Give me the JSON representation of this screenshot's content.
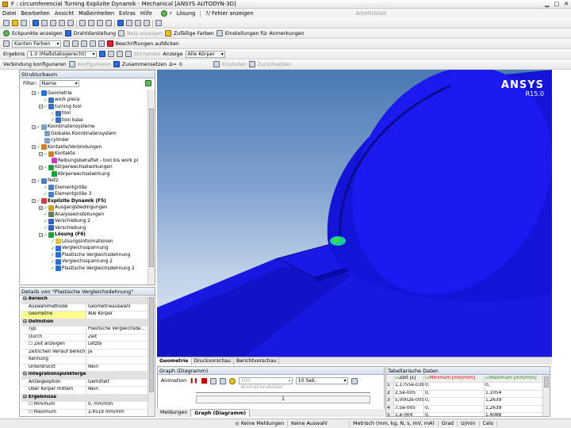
{
  "title": "F : circumferencial Turning Explizite Dynamik - Mechanical [ANSYS AUTODYN-3D]",
  "menu": [
    "Datei",
    "Bearbeiten",
    "Ansicht",
    "Maßeinheiten",
    "Extras",
    "Hilfe"
  ],
  "toolbar1": {
    "solve": "Lösung",
    "errors": "?/ Fehler anzeigen",
    "worksheet": "Arbeitsblatt"
  },
  "toolbar2": {
    "vertices": "Eckpunkte anzeigen",
    "wireframe": "Drahtdarstellung",
    "mesh": "Netz anzeigen",
    "random_colors": "Zufällige Farben",
    "annotation_settings": "Einstellungen für Anmerkungen"
  },
  "toolbar3": {
    "edges": "Kanten Farben",
    "labels": "Beschriftungen aufdicken"
  },
  "toolbar4": {
    "result_label": "Ergebnis",
    "scale": "1.0 (Maßstabsgerecht)",
    "probe": "Stichprobe",
    "show_label": "Anzeige",
    "all_bodies": "Alle Körper"
  },
  "toolbar5": {
    "connection": "Verbindung konfigurieren",
    "configure": "Konfigurieren",
    "merge": "Zusammensetzen",
    "delta": "Δ=",
    "delta_val": "0",
    "set": "Einstellen",
    "reset": "Zurücksetzen"
  },
  "tree_panel": {
    "title": "Strukturbaum",
    "filter_label": "Filter:",
    "filter_value": "Name",
    "items": [
      {
        "label": "Geometrie",
        "depth": 2,
        "color": "#2a6ed8",
        "exp": "−",
        "chk": true
      },
      {
        "label": "work piece",
        "depth": 3,
        "color": "#3a6fc0",
        "exp": "",
        "chk": true
      },
      {
        "label": "turning tool",
        "depth": 3,
        "color": "#3a6fc0",
        "exp": "−",
        "chk": true
      },
      {
        "label": "tool",
        "depth": 4,
        "color": "#3a6fc0",
        "exp": "",
        "chk": true
      },
      {
        "label": "tool base",
        "depth": 4,
        "color": "#3a6fc0",
        "exp": "",
        "chk": true
      },
      {
        "label": "Koordinatensysteme",
        "depth": 2,
        "color": "#7fa0c0",
        "exp": "−",
        "chk": true
      },
      {
        "label": "Globales Koordinatensystem",
        "depth": 3,
        "color": "#7fa0c0",
        "exp": "",
        "chk": false
      },
      {
        "label": "cylinder",
        "depth": 3,
        "color": "#7fa0c0",
        "exp": "",
        "chk": false
      },
      {
        "label": "Kontakte/Verbindungen",
        "depth": 2,
        "color": "#d08020",
        "exp": "−",
        "chk": true
      },
      {
        "label": "Kontakte",
        "depth": 3,
        "color": "#d08020",
        "exp": "−",
        "chk": true
      },
      {
        "label": "Reibungsbehaftet - tool bis work pi",
        "depth": 4,
        "color": "#c040c0",
        "exp": "",
        "chk": false
      },
      {
        "label": "Körperwechselwirkungen",
        "depth": 3,
        "color": "#20a040",
        "exp": "−",
        "chk": true
      },
      {
        "label": "Körperwechselwirkung",
        "depth": 4,
        "color": "#20a040",
        "exp": "",
        "chk": false
      },
      {
        "label": "Netz",
        "depth": 2,
        "color": "#4a80c0",
        "exp": "−",
        "chk": true
      },
      {
        "label": "Elementgröße",
        "depth": 3,
        "color": "#4a80c0",
        "exp": "",
        "chk": true
      },
      {
        "label": "Elementgröße 3",
        "depth": 3,
        "color": "#4a80c0",
        "exp": "",
        "chk": true
      },
      {
        "label": "Explizite Dynamik (F5)",
        "depth": 2,
        "color": "#d04040",
        "exp": "−",
        "chk": true,
        "bold": true
      },
      {
        "label": "Ausgangsbedingungen",
        "depth": 3,
        "color": "#d0a020",
        "exp": "+",
        "chk": true
      },
      {
        "label": "Analyseeinstellungen",
        "depth": 3,
        "color": "#608060",
        "exp": "",
        "chk": true
      },
      {
        "label": "Verschiebung 2",
        "depth": 3,
        "color": "#3060c0",
        "exp": "",
        "chk": true
      },
      {
        "label": "Verschiebung",
        "depth": 3,
        "color": "#3060c0",
        "exp": "",
        "chk": true
      },
      {
        "label": "Lösung (F6)",
        "depth": 3,
        "color": "#20a040",
        "exp": "−",
        "chk": true,
        "bold": true
      },
      {
        "label": "Lösungsinformationen",
        "depth": 4,
        "color": "#e0c040",
        "exp": "",
        "chk": true
      },
      {
        "label": "Vergleichsspannung",
        "depth": 4,
        "color": "#2a6ed8",
        "exp": "",
        "chk": true
      },
      {
        "label": "Plastische Vergleichsdehnung",
        "depth": 4,
        "color": "#2a6ed8",
        "exp": "",
        "chk": true
      },
      {
        "label": "Vergleichsspannung 2",
        "depth": 4,
        "color": "#2a6ed8",
        "exp": "",
        "chk": true
      },
      {
        "label": "Plastische Vergleichsdehnung 2",
        "depth": 4,
        "color": "#2a6ed8",
        "exp": "",
        "chk": true
      }
    ]
  },
  "details": {
    "title": "Details von \"Plastische Vergleichsdehnung\"",
    "rows": [
      {
        "k": "Bereich",
        "v": "",
        "sec": true
      },
      {
        "k": "Auswahlmethode",
        "v": "Geometrieauswahl"
      },
      {
        "k": "Geometrie",
        "v": "Alle Körper"
      },
      {
        "k": "Definition",
        "v": "",
        "sec": true
      },
      {
        "k": "Typ",
        "v": "Plastische Vergleichsde..."
      },
      {
        "k": "Durch",
        "v": "Zeit"
      },
      {
        "k": "Zeit anzeigen",
        "v": "Letzte",
        "box": true
      },
      {
        "k": "Zeitlichen Verlauf berechnen",
        "v": "Ja"
      },
      {
        "k": "Kennung",
        "v": ""
      },
      {
        "k": "Unterdrückt",
        "v": "Nein"
      },
      {
        "k": "Integrationspunktergebnisse",
        "v": "",
        "sec": true
      },
      {
        "k": "Anzeigeoption",
        "v": "Gemittelt"
      },
      {
        "k": "Über Körper mitteln",
        "v": "Nein"
      },
      {
        "k": "Ergebnisse",
        "v": "",
        "sec": true
      },
      {
        "k": "Minimum",
        "v": "0, mm/mm",
        "box": true
      },
      {
        "k": "Maximum",
        "v": "2,4519 mm/mm",
        "box": true
      }
    ]
  },
  "viewport": {
    "logo": "ANSYS",
    "version": "R15.0"
  },
  "view_tabs": [
    "Geometrie",
    "Druckvorschau",
    "Berichtvorschau"
  ],
  "graph": {
    "title": "Graph (Diagramm)",
    "animation": "Animation",
    "frames": "100 Animationsbilder",
    "duration": "10 Sek.",
    "slider_value": "1"
  },
  "bottom_tabs": [
    "Meldungen",
    "Graph (Diagramm)"
  ],
  "tabular": {
    "title": "Tabellarische Daten",
    "headers": [
      "",
      "Zeit [s]",
      "Minimum [mm/mm]",
      "Maximum [mm/mm]"
    ],
    "rows": [
      [
        "1",
        "1,1755e-038",
        "0,",
        "0,"
      ],
      [
        "2",
        "2,5e-005",
        "0,",
        "1,1054"
      ],
      [
        "3",
        "5,0002e-005",
        "0,",
        "1,2639"
      ],
      [
        "4",
        "7,5e-005",
        "0,",
        "1,2639"
      ],
      [
        "5",
        "1,e-004",
        "0,",
        "1,4088"
      ]
    ]
  },
  "status": {
    "messages": "Keine Meldungen",
    "selection": "Keine Auswahl",
    "units": "Metrisch (mm, kg, N, s, mV, mA)",
    "angle": "Grad",
    "speed": "U/min",
    "temp": "Cels"
  },
  "colors": {
    "model_blue": "#1010e8",
    "highlight_green": "#20a040",
    "accent": "#2a6ed8"
  }
}
